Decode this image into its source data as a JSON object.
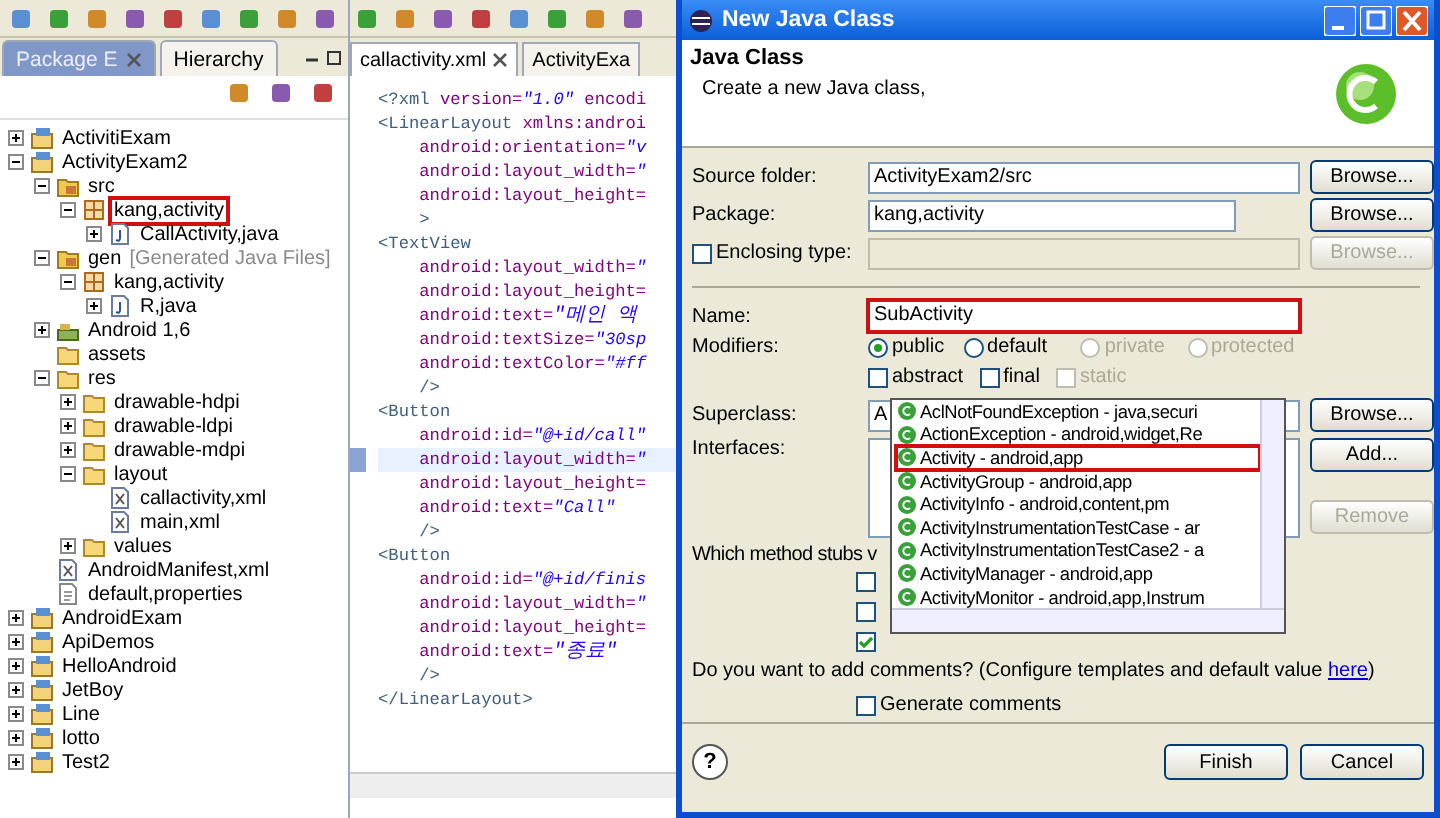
{
  "explorer": {
    "tabs": [
      {
        "label": "Package E",
        "selected": true,
        "closable": true
      },
      {
        "label": "Hierarchy",
        "selected": false,
        "closable": false
      }
    ],
    "tree": [
      {
        "label": "ActivitiExam",
        "kind": "project",
        "expanded": false
      },
      {
        "label": "ActivityExam2",
        "kind": "project",
        "expanded": true,
        "children": [
          {
            "label": "src",
            "kind": "src-folder",
            "expanded": true,
            "children": [
              {
                "label": "kang,activity",
                "kind": "package",
                "expanded": true,
                "marked": true,
                "children": [
                  {
                    "label": "CallActivity,java",
                    "kind": "java-file",
                    "expanded": false
                  }
                ]
              }
            ]
          },
          {
            "label": "gen",
            "note": "[Generated Java Files]",
            "kind": "src-folder",
            "expanded": true,
            "children": [
              {
                "label": "kang,activity",
                "kind": "package",
                "expanded": true,
                "children": [
                  {
                    "label": "R,java",
                    "kind": "java-file",
                    "expanded": false
                  }
                ]
              }
            ]
          },
          {
            "label": "Android 1,6",
            "kind": "library",
            "expanded": false
          },
          {
            "label": "assets",
            "kind": "folder"
          },
          {
            "label": "res",
            "kind": "folder",
            "expanded": true,
            "children": [
              {
                "label": "drawable-hdpi",
                "kind": "folder",
                "expanded": false
              },
              {
                "label": "drawable-ldpi",
                "kind": "folder",
                "expanded": false
              },
              {
                "label": "drawable-mdpi",
                "kind": "folder",
                "expanded": false
              },
              {
                "label": "layout",
                "kind": "folder",
                "expanded": true,
                "children": [
                  {
                    "label": "callactivity,xml",
                    "kind": "xml-file"
                  },
                  {
                    "label": "main,xml",
                    "kind": "xml-file"
                  }
                ]
              },
              {
                "label": "values",
                "kind": "folder",
                "expanded": false
              }
            ]
          },
          {
            "label": "AndroidManifest,xml",
            "kind": "xml-file"
          },
          {
            "label": "default,properties",
            "kind": "text-file"
          }
        ]
      },
      {
        "label": "AndroidExam",
        "kind": "project",
        "expanded": false
      },
      {
        "label": "ApiDemos",
        "kind": "project",
        "expanded": false
      },
      {
        "label": "HelloAndroid",
        "kind": "project",
        "expanded": false
      },
      {
        "label": "JetBoy",
        "kind": "project",
        "expanded": false
      },
      {
        "label": "Line",
        "kind": "project",
        "expanded": false
      },
      {
        "label": "lotto",
        "kind": "project",
        "expanded": false
      },
      {
        "label": "Test2",
        "kind": "project",
        "expanded": false
      }
    ]
  },
  "editor": {
    "tabs": [
      {
        "label": "callactivity.xml",
        "selected": true
      },
      {
        "label": "ActivityExa",
        "selected": false
      }
    ],
    "lines": [
      {
        "current": false,
        "segments": [
          {
            "kind": "tag",
            "text": "<?xml "
          },
          {
            "kind": "attr",
            "text": "version="
          },
          {
            "kind": "value",
            "text": "\"1.0\""
          },
          {
            "kind": "attr",
            "text": " encodi"
          }
        ]
      },
      {
        "current": false,
        "segments": [
          {
            "kind": "tag",
            "text": "<LinearLayout "
          },
          {
            "kind": "attr",
            "text": "xmlns:androi"
          }
        ]
      },
      {
        "current": false,
        "segments": [
          {
            "kind": "attr",
            "text": "    android:orientation="
          },
          {
            "kind": "value",
            "text": "\"v"
          }
        ]
      },
      {
        "current": false,
        "segments": [
          {
            "kind": "attr",
            "text": "    android:layout_width="
          },
          {
            "kind": "value",
            "text": "\""
          }
        ]
      },
      {
        "current": false,
        "segments": [
          {
            "kind": "attr",
            "text": "    android:layout_height="
          }
        ]
      },
      {
        "current": false,
        "segments": [
          {
            "kind": "tag",
            "text": "    >"
          }
        ]
      },
      {
        "current": false,
        "segments": [
          {
            "kind": "tag",
            "text": "<TextView"
          }
        ]
      },
      {
        "current": false,
        "segments": [
          {
            "kind": "attr",
            "text": "    android:layout_width="
          },
          {
            "kind": "value",
            "text": "\""
          }
        ]
      },
      {
        "current": false,
        "segments": [
          {
            "kind": "attr",
            "text": "    android:layout_height="
          }
        ]
      },
      {
        "current": false,
        "segments": [
          {
            "kind": "attr",
            "text": "    android:text="
          },
          {
            "kind": "value",
            "text": "\"메인 액"
          }
        ]
      },
      {
        "current": false,
        "segments": [
          {
            "kind": "attr",
            "text": "    android:textSize="
          },
          {
            "kind": "value",
            "text": "\"30sp"
          }
        ]
      },
      {
        "current": false,
        "segments": [
          {
            "kind": "attr",
            "text": "    android:textColor="
          },
          {
            "kind": "value",
            "text": "\"#ff"
          }
        ]
      },
      {
        "current": false,
        "segments": [
          {
            "kind": "tag",
            "text": "    />"
          }
        ]
      },
      {
        "current": false,
        "segments": [
          {
            "kind": "tag",
            "text": "<Button"
          }
        ]
      },
      {
        "current": false,
        "segments": [
          {
            "kind": "attr",
            "text": "    android:id="
          },
          {
            "kind": "value",
            "text": "\"@+id/call\""
          }
        ]
      },
      {
        "current": true,
        "segments": [
          {
            "kind": "attr",
            "text": "    android:layout_width="
          },
          {
            "kind": "value",
            "text": "\""
          }
        ]
      },
      {
        "current": false,
        "segments": [
          {
            "kind": "attr",
            "text": "    android:layout_height="
          }
        ]
      },
      {
        "current": false,
        "segments": [
          {
            "kind": "attr",
            "text": "    android:text="
          },
          {
            "kind": "value",
            "text": "\"Call\""
          }
        ]
      },
      {
        "current": false,
        "segments": [
          {
            "kind": "tag",
            "text": "    />"
          }
        ]
      },
      {
        "current": false,
        "segments": [
          {
            "kind": "tag",
            "text": "<Button"
          }
        ]
      },
      {
        "current": false,
        "segments": [
          {
            "kind": "attr",
            "text": "    android:id="
          },
          {
            "kind": "value",
            "text": "\"@+id/finis"
          }
        ]
      },
      {
        "current": false,
        "segments": [
          {
            "kind": "attr",
            "text": "    android:layout_width="
          },
          {
            "kind": "value",
            "text": "\""
          }
        ]
      },
      {
        "current": false,
        "segments": [
          {
            "kind": "attr",
            "text": "    android:layout_height="
          }
        ]
      },
      {
        "current": false,
        "segments": [
          {
            "kind": "attr",
            "text": "    android:text="
          },
          {
            "kind": "value",
            "text": "\"종료\""
          }
        ]
      },
      {
        "current": false,
        "segments": [
          {
            "kind": "tag",
            "text": "    />"
          }
        ]
      },
      {
        "current": false,
        "segments": [
          {
            "kind": "tag",
            "text": "</LinearLayout>"
          }
        ]
      }
    ]
  },
  "dialog": {
    "title": "New Java Class",
    "heading": "Java Class",
    "description": "Create a new Java class,",
    "source_folder": {
      "label": "Source folder:",
      "value": "ActivityExam2/src",
      "button": "Browse..."
    },
    "package": {
      "label": "Package:",
      "value": "kang,activity",
      "button": "Browse..."
    },
    "enclosing_type": {
      "label": "Enclosing type:",
      "checked": false,
      "button": "Browse...",
      "disabled": true
    },
    "name": {
      "label": "Name:",
      "value": "SubActivity",
      "marked": true
    },
    "modifiers": {
      "label": "Modifiers:",
      "radios": [
        {
          "label": "public",
          "selected": true,
          "disabled": false
        },
        {
          "label": "default",
          "selected": false,
          "disabled": false
        },
        {
          "label": "private",
          "selected": false,
          "disabled": true
        },
        {
          "label": "protected",
          "selected": false,
          "disabled": true
        }
      ],
      "checkboxes": [
        {
          "label": "abstract",
          "checked": false,
          "disabled": false
        },
        {
          "label": "final",
          "checked": false,
          "disabled": false
        },
        {
          "label": "static",
          "checked": false,
          "disabled": true
        }
      ]
    },
    "superclass": {
      "label": "Superclass:",
      "value": "A",
      "button": "Browse..."
    },
    "interfaces": {
      "label": "Interfaces:",
      "add": "Add...",
      "remove": "Remove",
      "remove_disabled": true
    },
    "stubs": {
      "label": "Which method stubs v",
      "options": [
        {
          "checked": false
        },
        {
          "checked": false
        },
        {
          "checked": true
        }
      ]
    },
    "comments": {
      "text": "Do you want to add comments? (Configure templates and default value ",
      "link": "here",
      "after": ")",
      "checkbox": {
        "label": "Generate comments",
        "checked": false
      }
    },
    "help": "?",
    "finish": "Finish",
    "cancel": "Cancel",
    "suggestions": [
      {
        "text": "AclNotFoundException - java,securi",
        "marked": false
      },
      {
        "text": "ActionException - android,widget,Re",
        "marked": false
      },
      {
        "text": "Activity - android,app",
        "marked": true
      },
      {
        "text": "ActivityGroup - android,app",
        "marked": false
      },
      {
        "text": "ActivityInfo - android,content,pm",
        "marked": false
      },
      {
        "text": "ActivityInstrumentationTestCase - ar",
        "marked": false
      },
      {
        "text": "ActivityInstrumentationTestCase2 - a",
        "marked": false
      },
      {
        "text": "ActivityManager - android,app",
        "marked": false
      },
      {
        "text": "ActivityMonitor - android,app,Instrum",
        "marked": false
      }
    ]
  }
}
